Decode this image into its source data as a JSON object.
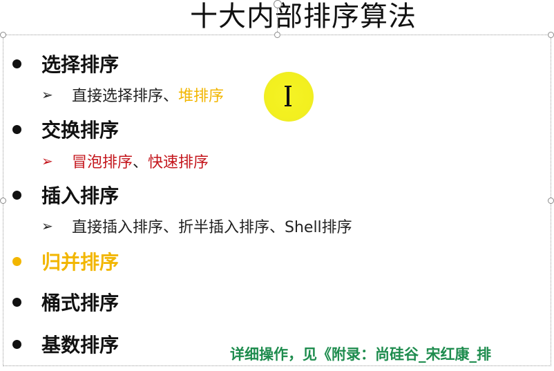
{
  "slide": {
    "title": "十大内部排序算法",
    "items": [
      {
        "label": "选择排序",
        "bullet_color": "#111111"
      },
      {
        "label": "交换排序",
        "bullet_color": "#111111"
      },
      {
        "label": "插入排序",
        "bullet_color": "#111111"
      },
      {
        "label": "归并排序",
        "bullet_color": "#f2b600"
      },
      {
        "label": "桶式排序",
        "bullet_color": "#111111"
      },
      {
        "label": "基数排序",
        "bullet_color": "#111111"
      }
    ],
    "subitems": {
      "selection": {
        "arrow": "➢",
        "part1": "直接选择排序、",
        "part2": "堆排序"
      },
      "exchange": {
        "arrow": "➢",
        "part1": "冒泡排序",
        "part2": "、",
        "part3": "快速排序"
      },
      "insertion": {
        "arrow": "➢",
        "text": "直接插入排序、折半插入排序、Shell排序"
      }
    },
    "footer_note": "详细操作，见《附录：尚硅谷_宋红康_排"
  },
  "colors": {
    "accent_orange": "#f2b600",
    "accent_red": "#c4161c",
    "note_green": "#1e8c4e",
    "cursor_highlight": "#f4f21a"
  },
  "icons": {
    "cursor": "i-beam-cursor-icon",
    "bullet": "filled-circle-bullet-icon",
    "sub_bullet": "arrowhead-bullet-icon"
  }
}
